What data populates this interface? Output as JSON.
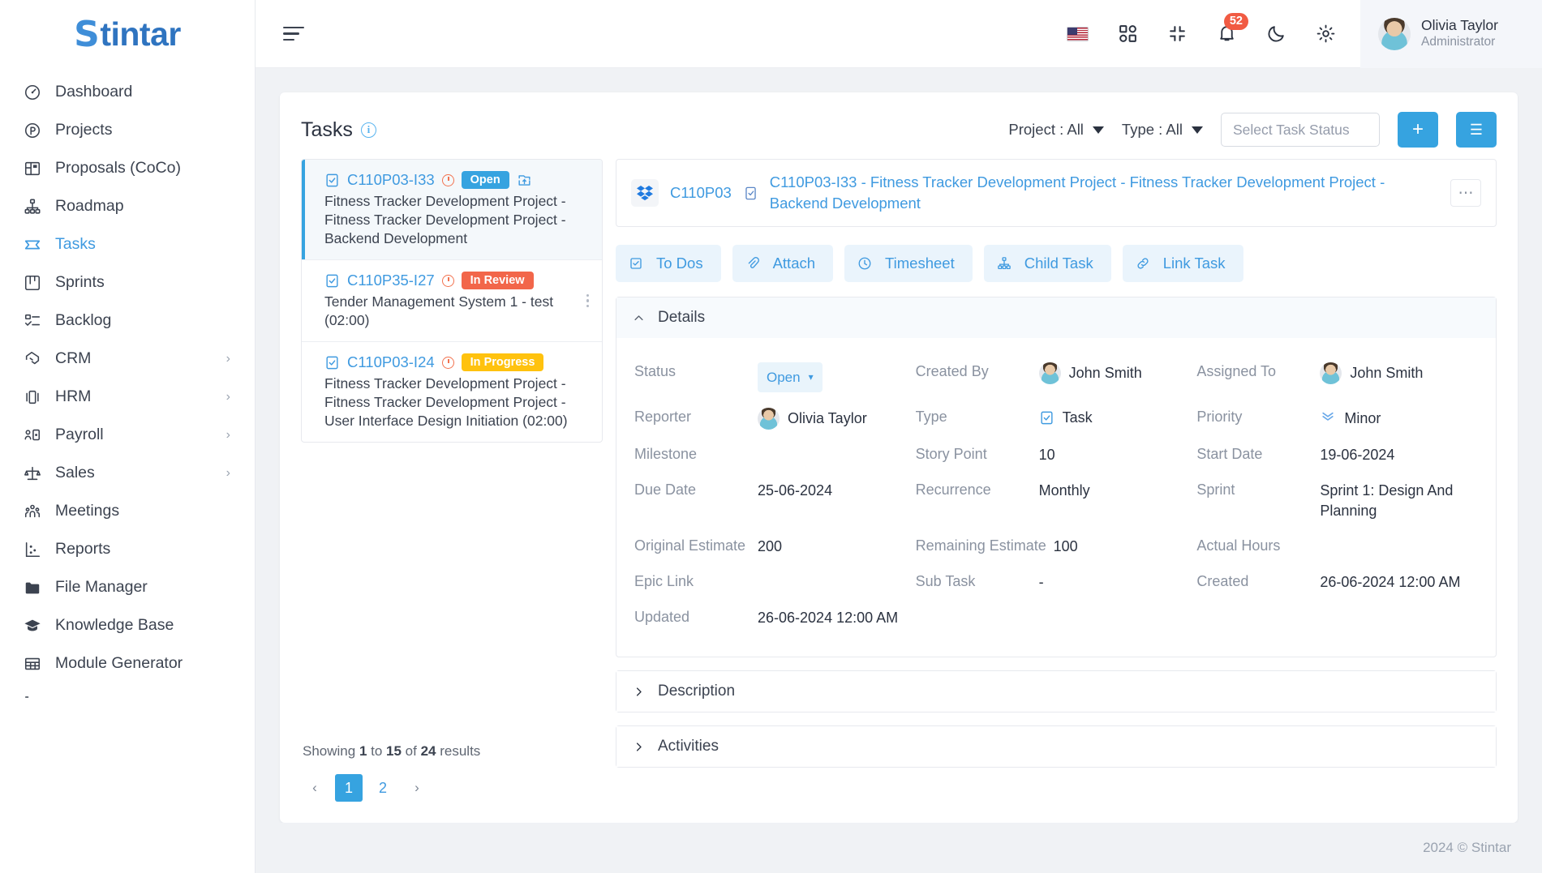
{
  "brand": {
    "name": "Stintar",
    "first_letter": "S",
    "rest": "tintar"
  },
  "sidebar": {
    "items": [
      {
        "label": "Dashboard",
        "icon": "gauge-icon",
        "has_chevron": false,
        "active": false
      },
      {
        "label": "Projects",
        "icon": "circle-p-icon",
        "has_chevron": false,
        "active": false
      },
      {
        "label": "Proposals (CoCo)",
        "icon": "layout-panel-icon",
        "has_chevron": false,
        "active": false
      },
      {
        "label": "Roadmap",
        "icon": "hierarchy-icon",
        "has_chevron": false,
        "active": false
      },
      {
        "label": "Tasks",
        "icon": "ticket-icon",
        "has_chevron": false,
        "active": true
      },
      {
        "label": "Sprints",
        "icon": "board-icon",
        "has_chevron": false,
        "active": false
      },
      {
        "label": "Backlog",
        "icon": "checklist-icon",
        "has_chevron": false,
        "active": false
      },
      {
        "label": "CRM",
        "icon": "handshake-icon",
        "has_chevron": true,
        "active": false
      },
      {
        "label": "HRM",
        "icon": "carousel-icon",
        "has_chevron": true,
        "active": false
      },
      {
        "label": "Payroll",
        "icon": "id-card-icon",
        "has_chevron": true,
        "active": false
      },
      {
        "label": "Sales",
        "icon": "scales-icon",
        "has_chevron": true,
        "active": false
      },
      {
        "label": "Meetings",
        "icon": "people-icon",
        "has_chevron": false,
        "active": false
      },
      {
        "label": "Reports",
        "icon": "scatter-chart-icon",
        "has_chevron": false,
        "active": false
      },
      {
        "label": "File Manager",
        "icon": "folder-icon",
        "has_chevron": false,
        "active": false
      },
      {
        "label": "Knowledge Base",
        "icon": "graduation-cap-icon",
        "has_chevron": false,
        "active": false
      },
      {
        "label": "Module Generator",
        "icon": "grid-table-icon",
        "has_chevron": false,
        "active": false
      }
    ]
  },
  "topbar": {
    "menu_icon": "hamburger-icon",
    "language_icon": "us-flag-icon",
    "apps_icon": "apps-grid-icon",
    "fullscreen_icon": "compress-icon",
    "notifications_icon": "bell-icon",
    "notification_count": "52",
    "theme_icon": "moon-icon",
    "settings_icon": "gear-icon",
    "user": {
      "name": "Olivia Taylor",
      "role": "Administrator"
    }
  },
  "page": {
    "title": "Tasks",
    "info_icon": "info-icon",
    "filters": [
      {
        "label": "Project : All"
      },
      {
        "label": "Type : All"
      }
    ],
    "status_select_placeholder": "Select Task Status",
    "add_button_label": "+",
    "list_button_label": "☰"
  },
  "task_list": {
    "items": [
      {
        "code": "C110P03-I33",
        "status": "Open",
        "status_kind": "open",
        "description": "Fitness Tracker Development Project - Fitness Tracker Development Project - Backend Development",
        "selected": true,
        "has_kanban_icon": true,
        "avatar": "photo"
      },
      {
        "code": "C110P35-I27",
        "status": "In Review",
        "status_kind": "review",
        "description": "Tender Management System 1 - test (02:00)",
        "selected": false,
        "has_kanban_icon": false,
        "avatar": "blank"
      },
      {
        "code": "C110P03-I24",
        "status": "In Progress",
        "status_kind": "progress",
        "description": "Fitness Tracker Development Project - Fitness Tracker Development Project - User Interface Design Initiation (02:00)",
        "selected": false,
        "has_kanban_icon": false,
        "avatar": "dark"
      }
    ],
    "showing_text": "Showing 1 to 15 of 24 results",
    "showing_prefix": "Showing ",
    "showing_from": "1",
    "showing_mid": " to ",
    "showing_to": "15",
    "showing_of": " of ",
    "showing_total": "24",
    "showing_suffix": " results",
    "pagination": {
      "prev": "‹",
      "pages": [
        "1",
        "2"
      ],
      "active_page": "1",
      "next": "›"
    }
  },
  "detail": {
    "project_code": "C110P03",
    "project_icon": "dropbox-icon",
    "task_type_icon": "task-clipboard-icon",
    "title": "C110P03-I33 - Fitness Tracker Development Project - Fitness Tracker Development Project - Backend Development",
    "more_button": "⋯",
    "tabs": [
      {
        "label": "To Dos",
        "icon": "checkbox-icon"
      },
      {
        "label": "Attach",
        "icon": "paperclip-icon"
      },
      {
        "label": "Timesheet",
        "icon": "clock-icon"
      },
      {
        "label": "Child Task",
        "icon": "hierarchy-icon"
      },
      {
        "label": "Link Task",
        "icon": "link-icon"
      }
    ],
    "sections": {
      "details": {
        "label": "Details",
        "expanded": true
      },
      "description": {
        "label": "Description",
        "expanded": false
      },
      "activities": {
        "label": "Activities",
        "expanded": false
      }
    },
    "fields": {
      "status": {
        "label": "Status",
        "value": "Open"
      },
      "created_by": {
        "label": "Created By",
        "value": "John Smith"
      },
      "assigned_to": {
        "label": "Assigned To",
        "value": "John Smith"
      },
      "reporter": {
        "label": "Reporter",
        "value": "Olivia Taylor"
      },
      "type": {
        "label": "Type",
        "value": "Task"
      },
      "priority": {
        "label": "Priority",
        "value": "Minor"
      },
      "milestone": {
        "label": "Milestone",
        "value": ""
      },
      "story_point": {
        "label": "Story Point",
        "value": "10"
      },
      "start_date": {
        "label": "Start Date",
        "value": "19-06-2024"
      },
      "due_date": {
        "label": "Due Date",
        "value": "25-06-2024"
      },
      "recurrence": {
        "label": "Recurrence",
        "value": "Monthly"
      },
      "sprint": {
        "label": "Sprint",
        "value": "Sprint 1: Design And Planning"
      },
      "original_estimate": {
        "label": "Original Estimate",
        "value": "200"
      },
      "remaining_estimate": {
        "label": "Remaining Estimate",
        "value": "100"
      },
      "actual_hours": {
        "label": "Actual Hours",
        "value": ""
      },
      "epic_link": {
        "label": "Epic Link",
        "value": ""
      },
      "sub_task": {
        "label": "Sub Task",
        "value": "-"
      },
      "created": {
        "label": "Created",
        "value": "26-06-2024 12:00 AM"
      },
      "updated": {
        "label": "Updated",
        "value": "26-06-2024 12:00 AM"
      }
    }
  },
  "footer": {
    "copyright": "2024 © Stintar"
  },
  "colors": {
    "accent": "#36a3e0",
    "link": "#3f9ae0",
    "danger": "#f2664a",
    "warning": "#ffc20e",
    "badge": "#f15b43"
  }
}
